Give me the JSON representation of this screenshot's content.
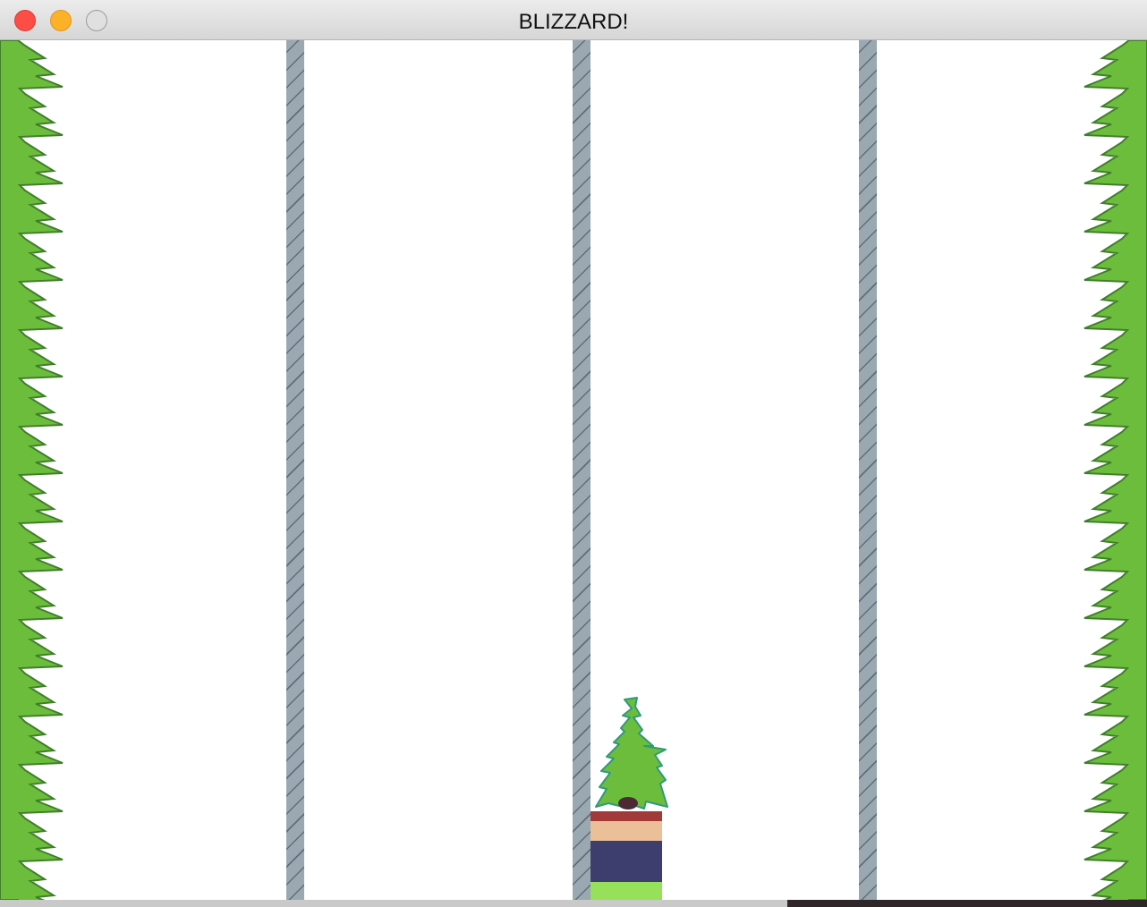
{
  "window": {
    "title": "BLIZZARD!"
  },
  "colors": {
    "tree_green": "#6dbd3c",
    "tree_outline": "#3f7f2a",
    "pole_fill": "#9aa8b2",
    "player_hat": "#a33a3a",
    "player_face": "#ebbf98",
    "player_body": "#3e3e6e",
    "player_legs": "#96e05a"
  },
  "scene": {
    "lanes": 4,
    "player_lane": 3,
    "obstacle": "pine-tree"
  }
}
